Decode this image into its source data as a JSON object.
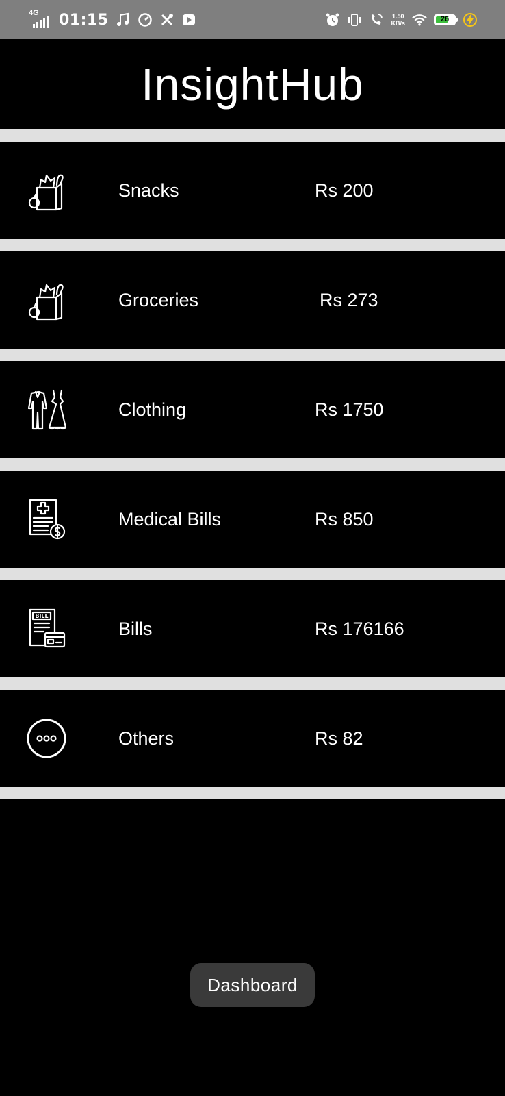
{
  "status_bar": {
    "network": "4G",
    "time": "01:15",
    "net_speed_value": "1.50",
    "net_speed_unit": "KB/s",
    "battery": "26",
    "icons_left": [
      "music-note-icon",
      "speedometer-icon",
      "tools-icon",
      "youtube-icon"
    ],
    "icons_right": [
      "alarm-icon",
      "vibrate-icon",
      "wifi-calling-icon",
      "wifi-icon",
      "battery-icon",
      "charging-icon"
    ]
  },
  "header": {
    "title": "InsightHub"
  },
  "categories": [
    {
      "icon": "grocery-bag-icon",
      "name": "Snacks",
      "amount": "Rs 200"
    },
    {
      "icon": "grocery-bag-icon",
      "name": "Groceries",
      "amount": "Rs 273"
    },
    {
      "icon": "clothing-icon",
      "name": "Clothing",
      "amount": "Rs 1750"
    },
    {
      "icon": "medical-bill-icon",
      "name": "Medical Bills",
      "amount": "Rs 850"
    },
    {
      "icon": "bill-card-icon",
      "name": "Bills",
      "amount": "Rs 176166"
    },
    {
      "icon": "more-options-icon",
      "name": "Others",
      "amount": "Rs 82"
    }
  ],
  "dashboard_button": {
    "label": "Dashboard"
  },
  "colors": {
    "background": "#000000",
    "divider": "#e0e0e0",
    "status_bar": "#7f7f7f",
    "button": "#3a3a3a",
    "battery_fill": "#3dbf3d",
    "charging": "#f5c518"
  }
}
